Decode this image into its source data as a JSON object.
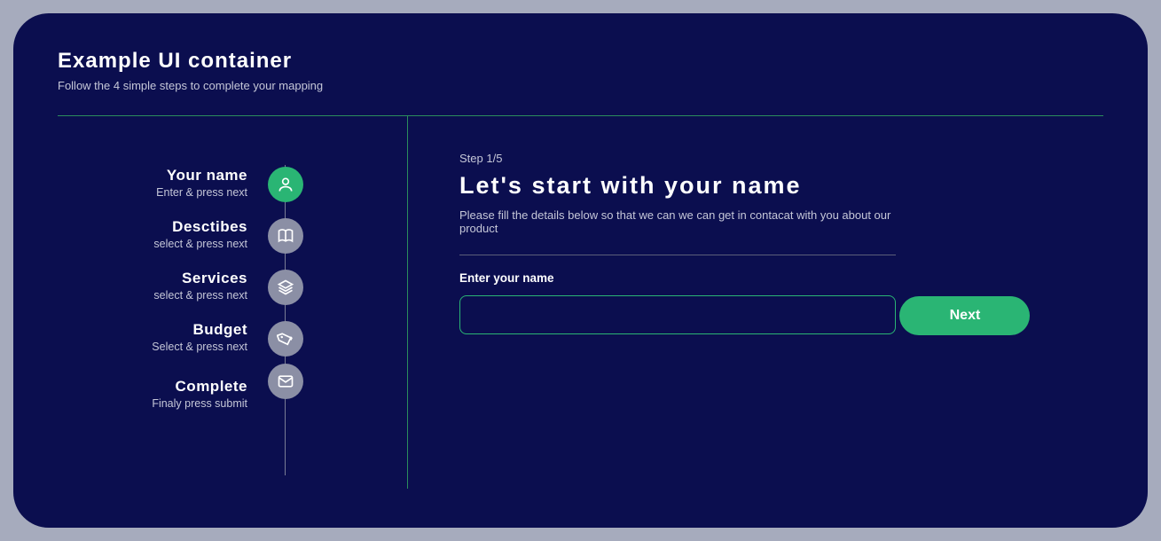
{
  "header": {
    "title": "Example UI container",
    "subtitle": "Follow the 4 simple steps to complete your mapping"
  },
  "sidebar": {
    "steps": [
      {
        "title": "Your name",
        "subtitle": "Enter & press next",
        "icon": "user",
        "active": true
      },
      {
        "title": "Desctibes",
        "subtitle": "select & press next",
        "icon": "book",
        "active": false
      },
      {
        "title": "Services",
        "subtitle": "select & press next",
        "icon": "layers",
        "active": false
      },
      {
        "title": "Budget",
        "subtitle": "Select & press next",
        "icon": "tag",
        "active": false
      },
      {
        "title": "Complete",
        "subtitle": "Finaly press submit",
        "icon": "mail",
        "active": false
      }
    ]
  },
  "main": {
    "step_counter": "Step 1/5",
    "heading": "Let's start with your name",
    "description": "Please fill the details below so that we can we can get in contacat with you about our product",
    "form": {
      "label": "Enter your name",
      "value": "",
      "placeholder": ""
    },
    "next_button": "Next"
  },
  "colors": {
    "accent": "#2ab574",
    "background": "#0b0e4f",
    "page_background": "#a6abbd",
    "inactive": "#8b8fa5"
  }
}
